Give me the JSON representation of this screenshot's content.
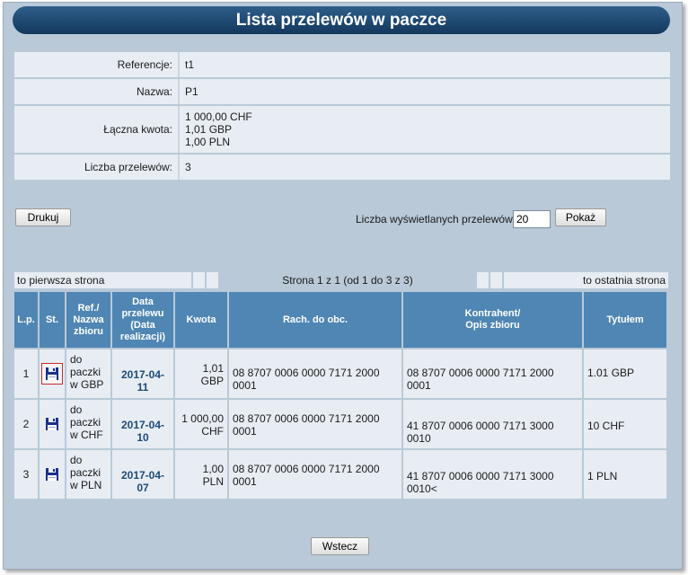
{
  "page_title": "Lista przelewów w paczce",
  "info": [
    {
      "label": "Referencje:",
      "value": "t1"
    },
    {
      "label": "Nazwa:",
      "value": "P1"
    },
    {
      "label": "Łączna kwota:",
      "value_lines": [
        "1 000,00 CHF",
        "1,01 GBP",
        "1,00 PLN"
      ]
    },
    {
      "label": "Liczba przelewów:",
      "value": "3"
    }
  ],
  "print_button": "Drukuj",
  "count_label": "Liczba wyświetlanych przelewów:",
  "count_value": "20",
  "show_button": "Pokaż",
  "pager": {
    "first": "to pierwsza strona",
    "info": "Strona 1 z 1 (od 1 do 3 z 3)",
    "last": "to ostatnia strona"
  },
  "columns": {
    "lp": "L.p.",
    "st": "St.",
    "ref": [
      "Ref./",
      "Nazwa",
      "zbioru"
    ],
    "date": [
      "Data",
      "przelewu",
      "(Data",
      "realizacji)"
    ],
    "amount": "Kwota",
    "account": "Rach. do obc.",
    "contractor": [
      "Kontrahent/",
      "Opis zbioru"
    ],
    "title": "Tytułem"
  },
  "rows": [
    {
      "lp": "1",
      "status_icon": "floppy-disk-icon",
      "ref": [
        "do",
        "paczki",
        "w GBP"
      ],
      "date": "2017-04-11",
      "amount": [
        "1,01",
        "GBP"
      ],
      "account": "08 8707 0006 0000 7171 2000 0001",
      "contractor": "08 8707 0006 0000 7171 2000 0001",
      "title": "1.01 GBP"
    },
    {
      "lp": "2",
      "status_icon": "floppy-disk-icon",
      "ref": [
        "do",
        "paczki",
        "w CHF"
      ],
      "date": "2017-04-10",
      "amount": [
        "1 000,00",
        "CHF"
      ],
      "account": "08 8707 0006 0000 7171 2000 0001",
      "contractor": "41 8707 0006 0000 7171 3000 0010",
      "title": "10 CHF"
    },
    {
      "lp": "3",
      "status_icon": "floppy-disk-icon",
      "ref": [
        "do",
        "paczki",
        "w PLN"
      ],
      "date": "2017-04-07",
      "amount": [
        "1,00",
        "PLN"
      ],
      "account": "08 8707 0006 0000 7171 2000 0001",
      "contractor": "41 8707 0006 0000 7171 3000 0010<",
      "title": "1 PLN"
    }
  ],
  "back_button": "Wstecz",
  "colors": {
    "header_bg": "#1f4a74",
    "table_header": "#4f86b3",
    "panel": "#b9c9d8",
    "cell": "#e7edf3",
    "date_text": "#1d4a78"
  }
}
